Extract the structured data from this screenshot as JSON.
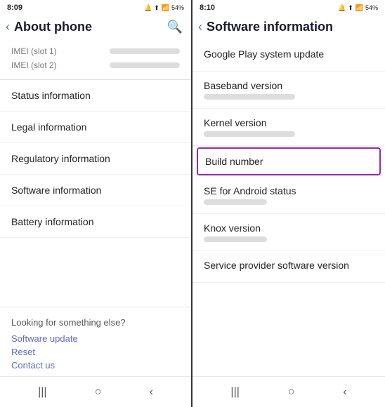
{
  "left_panel": {
    "status_bar": {
      "time": "8:09",
      "icons": "🔔 ☁ ⬆ 📶 54%"
    },
    "header": {
      "back_label": "‹",
      "title": "About phone",
      "search_icon": "🔍"
    },
    "imei": {
      "slot1_label": "IMEI (slot 1)",
      "slot2_label": "IMEI (slot 2)"
    },
    "menu_items": [
      {
        "label": "Status information"
      },
      {
        "label": "Legal information"
      },
      {
        "label": "Regulatory information"
      },
      {
        "label": "Software information",
        "has_arrow": true
      },
      {
        "label": "Battery information"
      }
    ],
    "looking_section": {
      "title": "Looking for something else?",
      "links": [
        "Software update",
        "Reset",
        "Contact us"
      ]
    },
    "bottom_nav": {
      "recents": "|||",
      "home": "○",
      "back": "‹"
    }
  },
  "right_panel": {
    "status_bar": {
      "time": "8:10",
      "icons": "🔔 ☁ ⬆ 📶 54%"
    },
    "header": {
      "back_label": "‹",
      "title": "Software information"
    },
    "items": [
      {
        "label": "Google Play system update",
        "has_value": false
      },
      {
        "label": "Baseband version",
        "has_value": true
      },
      {
        "label": "Kernel version",
        "has_value": true
      },
      {
        "label": "Build number",
        "has_value": false,
        "highlighted": true
      },
      {
        "label": "SE for Android status",
        "has_value": true
      },
      {
        "label": "Knox version",
        "has_value": true
      },
      {
        "label": "Service provider software version",
        "has_value": false
      }
    ],
    "bottom_nav": {
      "recents": "|||",
      "home": "○",
      "back": "‹"
    }
  }
}
